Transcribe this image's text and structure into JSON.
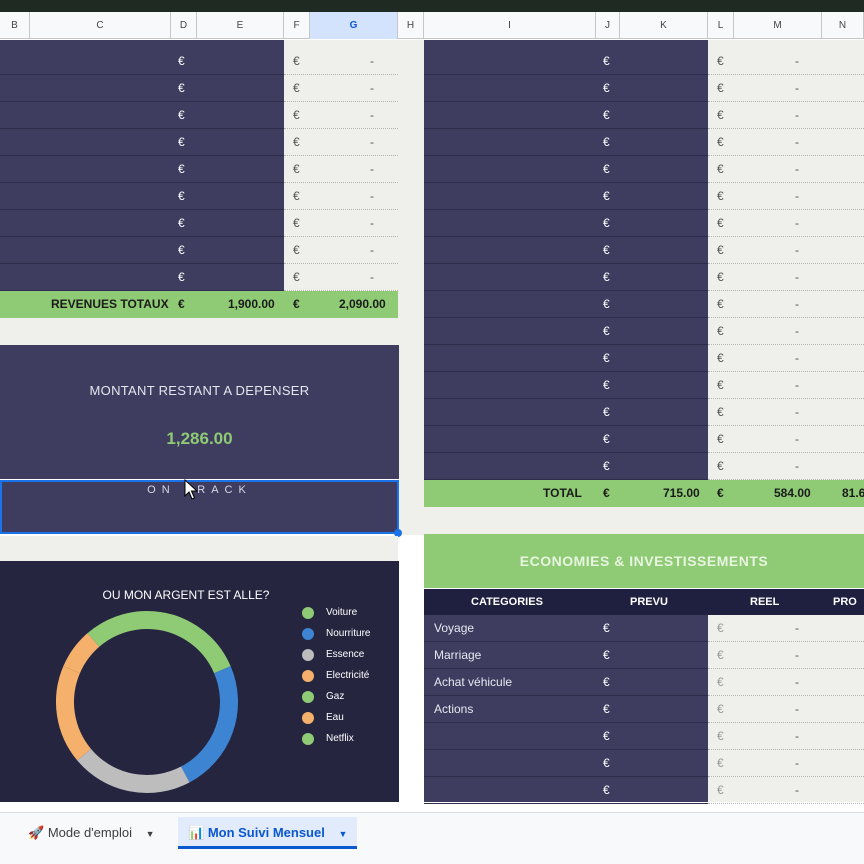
{
  "columns": [
    "B",
    "C",
    "D",
    "E",
    "F",
    "G",
    "H",
    "I",
    "J",
    "K",
    "L",
    "M",
    "N"
  ],
  "selected_columns": [
    "G"
  ],
  "currency": "€",
  "dash": "-",
  "revenus": {
    "label": "REVENUES TOTAUX",
    "prevu": "1,900.00",
    "reel": "2,090.00"
  },
  "total": {
    "label": "TOTAL",
    "prevu": "715.00",
    "reel": "584.00",
    "extra": "81.6"
  },
  "remaining": {
    "title": "MONTANT RESTANT A DEPENSER",
    "amount": "1,286.00",
    "status": "ON TRACK"
  },
  "chart_data": {
    "type": "pie",
    "title": "OU MON ARGENT EST ALLE?",
    "categories": [
      "Voiture",
      "Nourriture",
      "Essence",
      "Electricité",
      "Gaz",
      "Eau",
      "Netflix"
    ],
    "values": [
      18,
      23,
      21,
      17,
      0,
      7,
      11
    ],
    "colors": [
      "#8fca74",
      "#3d85d3",
      "#bdbdbd",
      "#f5b06b",
      "#8fca74",
      "#f5b06b",
      "#8fca74"
    ],
    "donut": true,
    "legend": "right"
  },
  "economies": {
    "title": "ECONOMIES & INVESTISSEMENTS",
    "headers": [
      "CATEGORIES",
      "PREVU",
      "REEL",
      "PRO"
    ],
    "rows": [
      "Voyage",
      "Marriage",
      "Achat véhicule",
      "Actions",
      "",
      "",
      ""
    ]
  },
  "tabs": [
    {
      "label": "Mode d'emploi",
      "icon": "🚀"
    },
    {
      "label": "Mon Suivi Mensuel",
      "icon": "📊"
    }
  ]
}
